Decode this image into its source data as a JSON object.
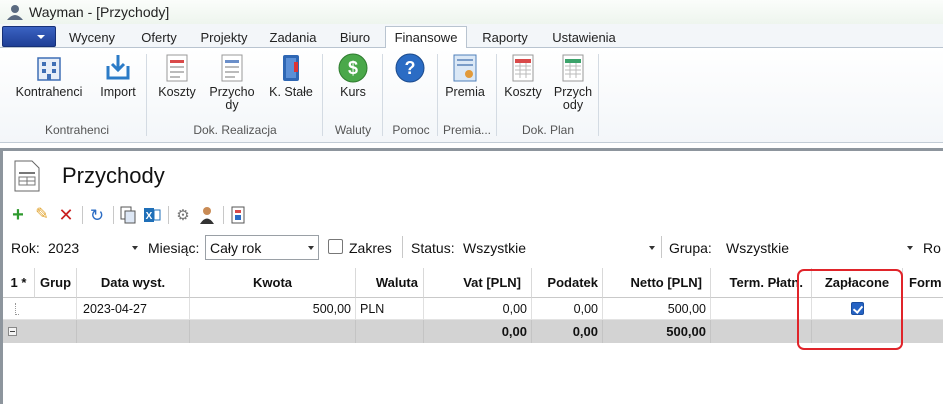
{
  "window": {
    "title": "Wayman - [Przychody]"
  },
  "tabs": [
    "Wyceny",
    "Oferty",
    "Projekty",
    "Zadania",
    "Biuro",
    "Finansowe",
    "Raporty",
    "Ustawienia"
  ],
  "active_tab": "Finansowe",
  "ribbon": {
    "buttons": {
      "kontrahenci": "Kontrahenci",
      "import": "Import",
      "koszty": "Koszty",
      "przychody": "Przycho dy",
      "k_stale": "K. Stałe",
      "kurs": "Kurs",
      "premia": "Premia",
      "plan_koszty": "Koszty",
      "plan_przychody": "Przych ody"
    },
    "groups": {
      "kontrahenci": "Kontrahenci",
      "dok_realizacja": "Dok. Realizacja",
      "waluty": "Waluty",
      "pomoc": "Pomoc",
      "premia": "Premia...",
      "dok_plan": "Dok. Plan"
    }
  },
  "page": {
    "title": "Przychody"
  },
  "filters": {
    "rok_label": "Rok:",
    "rok_value": "2023",
    "miesiac_label": "Miesiąc:",
    "miesiac_value": "Cały rok",
    "zakres_label": "Zakres",
    "status_label": "Status:",
    "status_value": "Wszystkie",
    "grupa_label": "Grupa:",
    "grupa_value": "Wszystkie",
    "ro_label": "Ro"
  },
  "grid": {
    "headers": [
      "1 *",
      "Grup",
      "Data wyst.",
      "Kwota",
      "Waluta",
      "Vat  [PLN]",
      "Podatek",
      "Netto  [PLN]",
      "Term. Płatn.",
      "Zapłacone",
      "Form"
    ],
    "rows": [
      {
        "data": "2023-04-27",
        "kwota": "500,00",
        "waluta": "PLN",
        "vat": "0,00",
        "podatek": "0,00",
        "netto": "500,00",
        "term": "",
        "zaplacone": true
      }
    ],
    "totals": {
      "vat": "0,00",
      "podatek": "0,00",
      "netto": "500,00"
    }
  },
  "colors": {
    "highlight": "#e0242a",
    "accent": "#2563c4",
    "ribbon_menu": "#2a4fae"
  }
}
